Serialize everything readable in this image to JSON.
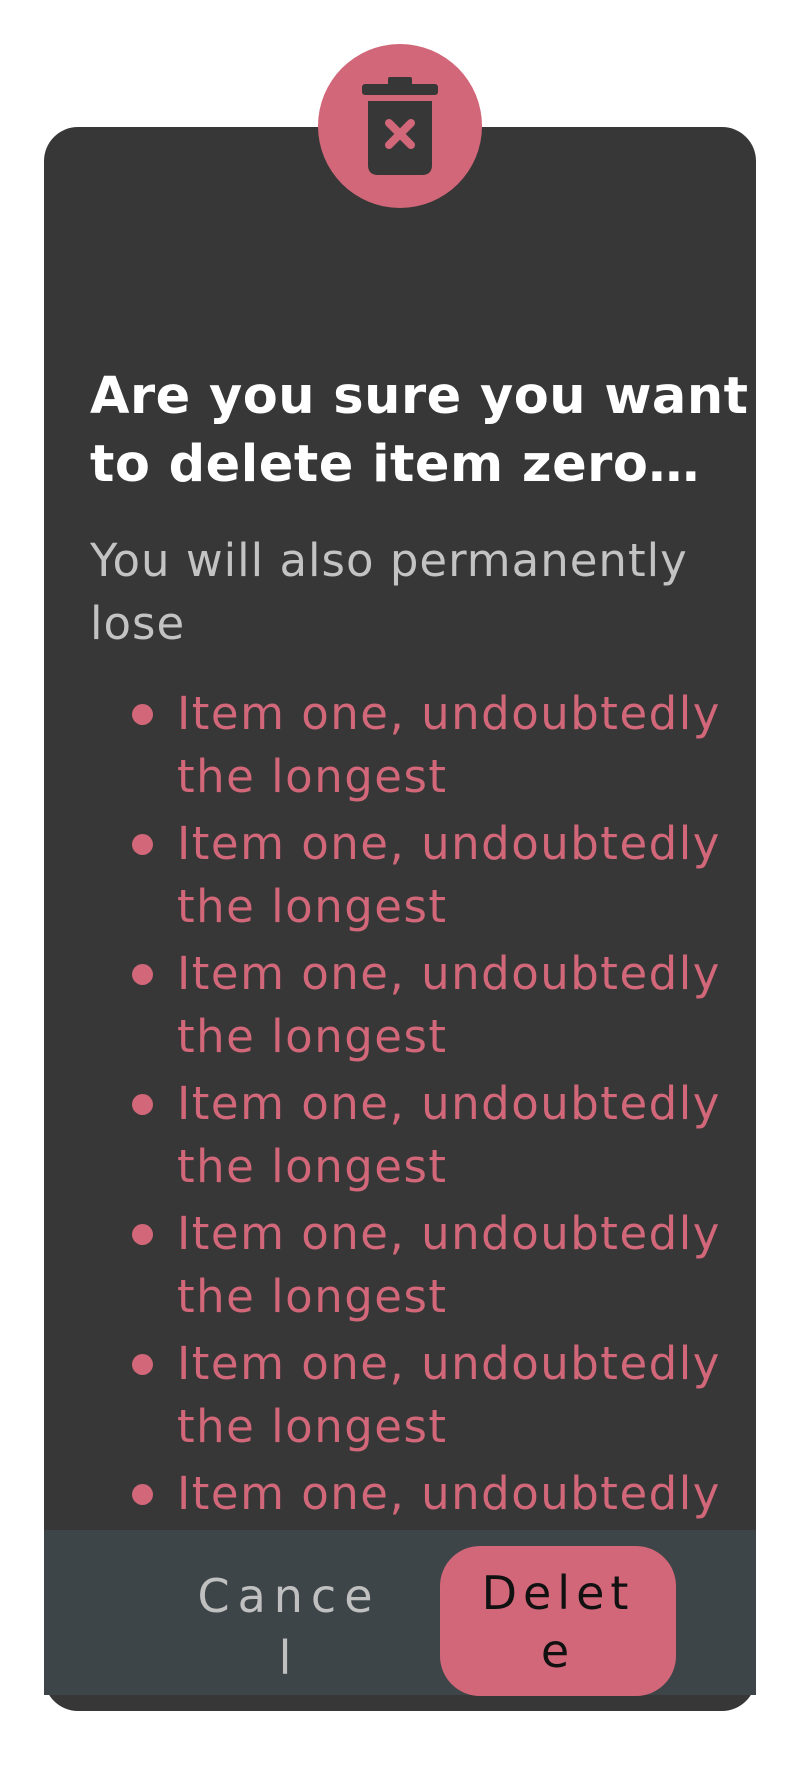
{
  "dialog": {
    "icon": "trash-x-icon",
    "title": "Are you sure you want to delete item zero forever and ever?",
    "subtitle": "You will also permanently lose",
    "items": [
      "Item one, undoubtedly the longest",
      "Item one, undoubtedly the longest",
      "Item one, undoubtedly the longest",
      "Item one, undoubtedly the longest",
      "Item one, undoubtedly the longest",
      "Item one, undoubtedly the longest",
      "Item one, undoubtedly the longest"
    ],
    "cancel_label": "Cancel",
    "delete_label": "Delete"
  },
  "colors": {
    "dialog_bg": "#373737",
    "footer_bg": "#3e4548",
    "accent": "#d16778",
    "title": "#ffffff",
    "subtitle": "#c3c3c3"
  }
}
